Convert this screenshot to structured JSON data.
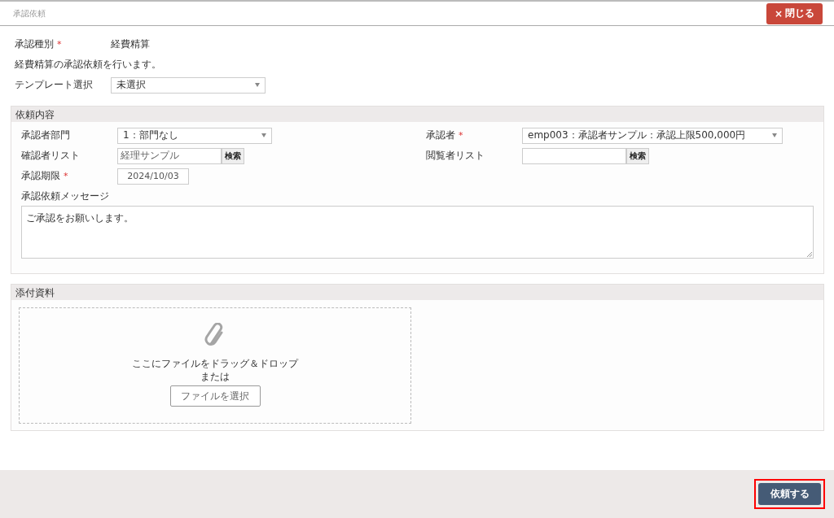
{
  "window": {
    "title": "承認依頼",
    "close_button": {
      "icon": "×",
      "label": "閉じる"
    }
  },
  "approval_type": {
    "label": "承認種別",
    "required_mark": "*",
    "value": "経費精算"
  },
  "description": "経費精算の承認依頼を行います。",
  "template": {
    "label": "テンプレート選択",
    "value": "未選択"
  },
  "request_section": {
    "title": "依頼内容",
    "fields": [
      {
        "kind": "select",
        "label": "承認者部門",
        "value": "1：部門なし"
      },
      {
        "kind": "select",
        "label": "承認者",
        "required_mark": "*",
        "value": "emp003：承認者サンプル：承認上限500,000円"
      },
      {
        "kind": "search",
        "label": "確認者リスト",
        "value": "経理サンプル",
        "button": "検索"
      },
      {
        "kind": "search",
        "label": "閲覧者リスト",
        "button": "検索"
      },
      {
        "kind": "date",
        "label": "承認期限",
        "required_mark": "*",
        "value": "2024/10/03"
      }
    ],
    "message": {
      "label": "承認依頼メッセージ",
      "value": "ご承認をお願いします。"
    }
  },
  "attachments": {
    "title": "添付資料",
    "drop_text": "ここにファイルをドラッグ＆ドロップ",
    "or_text": "または",
    "select_button": "ファイルを選択"
  },
  "footer": {
    "submit_button": {
      "label": "依頼する",
      "highlighted": true
    }
  }
}
